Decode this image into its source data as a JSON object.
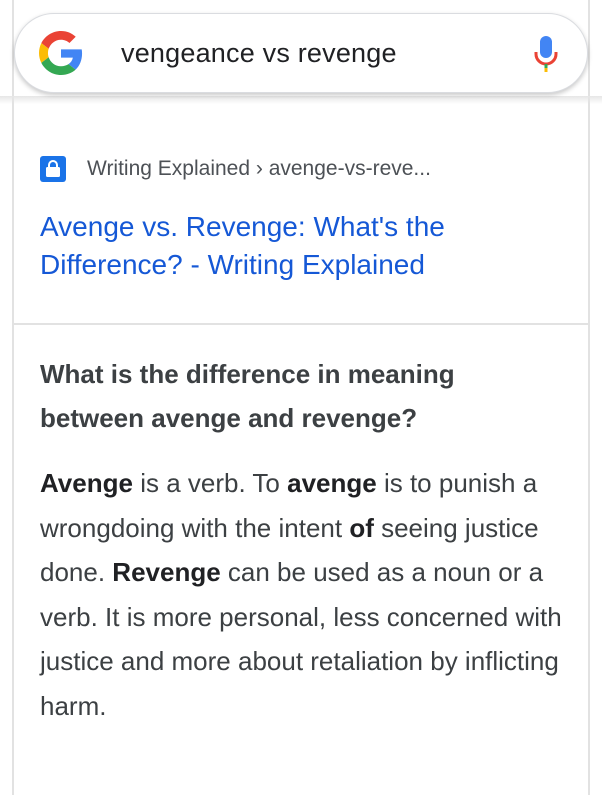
{
  "search": {
    "query": "vengeance vs revenge",
    "logo": "google-g-logo",
    "mic_icon": "microphone-icon"
  },
  "result": {
    "favicon": "lock-favicon-icon",
    "source": "Writing Explained › avenge-vs-reve...",
    "title": "Avenge vs. Revenge: What's the Difference? - Writing Explained"
  },
  "featured": {
    "question": "What is the difference in meaning between avenge and revenge?",
    "answer_parts": {
      "p1": "Avenge",
      "p2": " is a verb. To ",
      "p3": "avenge",
      "p4": " is to punish a wrongdoing with the intent ",
      "p5": "of",
      "p6": " seeing justice done. ",
      "p7": "Revenge",
      "p8": " can be used as a noun or a verb. It is more personal, less concerned with justice and more about retaliation by inflicting harm."
    }
  },
  "colors": {
    "link": "#1558d6",
    "text": "#3c4043",
    "favicon_bg": "#1a73e8"
  }
}
